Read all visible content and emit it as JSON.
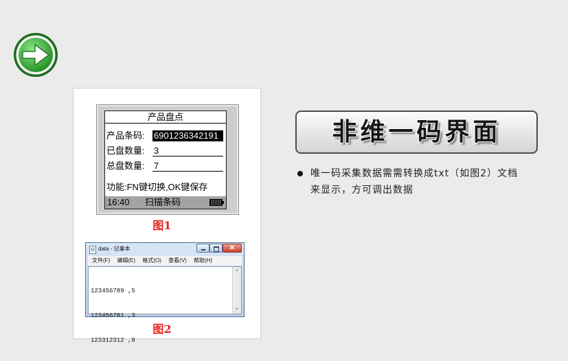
{
  "nav": {
    "next_icon": "arrow-right-circle-icon"
  },
  "figure1": {
    "screen_title": "产品盘点",
    "fields": [
      {
        "label": "产品条码:",
        "value": "6901236342191"
      },
      {
        "label": "已盘数量:",
        "value": "3"
      },
      {
        "label": "总盘数量:",
        "value": "7"
      }
    ],
    "function_hint": "功能:FN键切换,OK键保存",
    "status": {
      "time": "16:40",
      "mode": "扫描条码",
      "battery_icon": "battery-icon"
    },
    "caption": "图1"
  },
  "figure2": {
    "window_title": "data - 记事本",
    "close_glyph": "✕",
    "menu": [
      "文件(F)",
      "编辑(E)",
      "格式(O)",
      "查看(V)",
      "帮助(H)"
    ],
    "lines": [
      "123456789 ,5",
      "123456781 ,3",
      "123312312 ,8"
    ],
    "caption": "图2"
  },
  "heading": "非维一码界面",
  "bullet": {
    "lines": [
      "唯一码采集数据需需转换成txt（如图2）文档",
      "来显示，方可调出数据"
    ]
  },
  "colors": {
    "page_bg": "#ebebeb",
    "caption_red": "#e3231b",
    "arrow_green": "#2e9e2e",
    "heading_text": "#161616",
    "highlight_bg": "#000000"
  }
}
